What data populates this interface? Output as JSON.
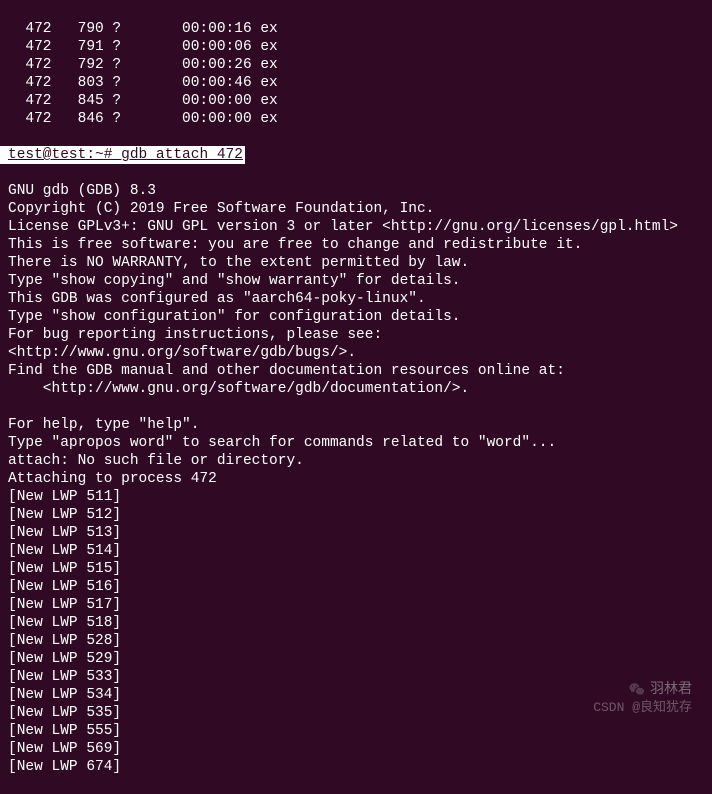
{
  "ps_rows": [
    {
      "c1": "472",
      "c2": "790",
      "c3": "?",
      "c4": "00:00:16",
      "c5": "ex"
    },
    {
      "c1": "472",
      "c2": "791",
      "c3": "?",
      "c4": "00:00:06",
      "c5": "ex"
    },
    {
      "c1": "472",
      "c2": "792",
      "c3": "?",
      "c4": "00:00:26",
      "c5": "ex"
    },
    {
      "c1": "472",
      "c2": "803",
      "c3": "?",
      "c4": "00:00:46",
      "c5": "ex"
    },
    {
      "c1": "472",
      "c2": "845",
      "c3": "?",
      "c4": "00:00:00",
      "c5": "ex"
    },
    {
      "c1": "472",
      "c2": "846",
      "c3": "?",
      "c4": "00:00:00",
      "c5": "ex"
    }
  ],
  "prompt": {
    "user_host": "test@test:~# ",
    "command": "gdb attach 472"
  },
  "gdb_output": [
    "GNU gdb (GDB) 8.3",
    "Copyright (C) 2019 Free Software Foundation, Inc.",
    "License GPLv3+: GNU GPL version 3 or later <http://gnu.org/licenses/gpl.html>",
    "This is free software: you are free to change and redistribute it.",
    "There is NO WARRANTY, to the extent permitted by law.",
    "Type \"show copying\" and \"show warranty\" for details.",
    "This GDB was configured as \"aarch64-poky-linux\".",
    "Type \"show configuration\" for configuration details.",
    "For bug reporting instructions, please see:",
    "<http://www.gnu.org/software/gdb/bugs/>.",
    "Find the GDB manual and other documentation resources online at:",
    "    <http://www.gnu.org/software/gdb/documentation/>.",
    "",
    "For help, type \"help\".",
    "Type \"apropos word\" to search for commands related to \"word\"...",
    "attach: No such file or directory.",
    "Attaching to process 472",
    "[New LWP 511]",
    "[New LWP 512]",
    "[New LWP 513]",
    "[New LWP 514]",
    "[New LWP 515]",
    "[New LWP 516]",
    "[New LWP 517]",
    "[New LWP 518]",
    "[New LWP 528]",
    "[New LWP 529]",
    "[New LWP 533]",
    "[New LWP 534]",
    "[New LWP 535]",
    "[New LWP 555]",
    "[New LWP 569]",
    "[New LWP 674]"
  ],
  "watermark": {
    "text1": "羽林君",
    "text2": "CSDN @良知犹存"
  }
}
